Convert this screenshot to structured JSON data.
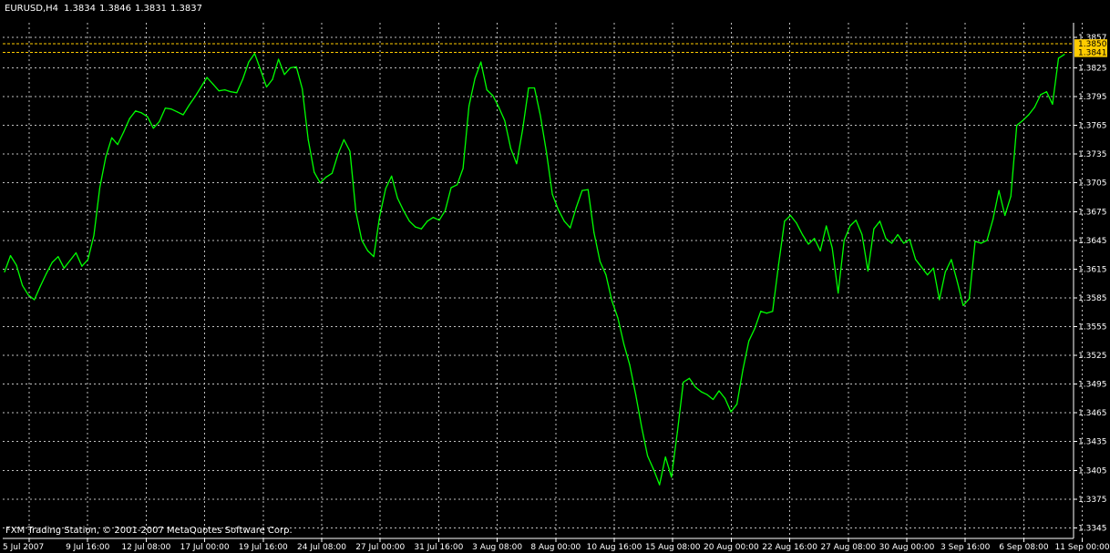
{
  "header": {
    "symbol": "EURUSD,H4",
    "open": "1.3834",
    "high": "1.3846",
    "low": "1.3831",
    "close": "1.3837"
  },
  "footer": {
    "copyright": "FXM Trading Station, © 2001-2007 MetaQuotes Software Corp."
  },
  "colors": {
    "background": "#000000",
    "grid": "#c0c0c0",
    "axis": "#ffffff",
    "line": "#00ff00",
    "price_tag": "#ffcc00"
  },
  "chart_data": {
    "type": "line",
    "title": "EURUSD,H4",
    "xlabel": "",
    "ylabel": "",
    "grid": true,
    "ylim": [
      1.3334,
      1.3872
    ],
    "y_ticks": [
      "1.3345",
      "1.3375",
      "1.3405",
      "1.3435",
      "1.3465",
      "1.3495",
      "1.3525",
      "1.3555",
      "1.3585",
      "1.3615",
      "1.3645",
      "1.3675",
      "1.3705",
      "1.3735",
      "1.3765",
      "1.3795",
      "1.3825",
      "1.3857"
    ],
    "x_ticks": [
      "5 Jul 2007",
      "9 Jul 16:00",
      "12 Jul 08:00",
      "17 Jul 00:00",
      "19 Jul 16:00",
      "24 Jul 08:00",
      "27 Jul 00:00",
      "31 Jul 16:00",
      "3 Aug 08:00",
      "8 Aug 00:00",
      "10 Aug 16:00",
      "15 Aug 08:00",
      "20 Aug 00:00",
      "22 Aug 16:00",
      "27 Aug 08:00",
      "30 Aug 00:00",
      "3 Sep 16:00",
      "6 Sep 08:00",
      "11 Sep 00:00"
    ],
    "price_tags": [
      {
        "label": "1.3850",
        "value": 1.385,
        "color": "#ffcc00"
      },
      {
        "label": "1.3841",
        "value": 1.3841,
        "color": "#ffcc00"
      }
    ],
    "series": [
      {
        "values": [
          [
            0,
            1.3612
          ],
          [
            1,
            1.3629
          ],
          [
            2,
            1.3619
          ],
          [
            3,
            1.3598
          ],
          [
            4,
            1.3588
          ],
          [
            5,
            1.3583
          ],
          [
            6,
            1.3597
          ],
          [
            7,
            1.361
          ],
          [
            8,
            1.3622
          ],
          [
            9,
            1.3628
          ],
          [
            10,
            1.3616
          ],
          [
            11,
            1.3624
          ],
          [
            12,
            1.3632
          ],
          [
            13,
            1.3618
          ],
          [
            14,
            1.3625
          ],
          [
            15,
            1.365
          ],
          [
            16,
            1.37
          ],
          [
            17,
            1.3732
          ],
          [
            18,
            1.3752
          ],
          [
            19,
            1.3745
          ],
          [
            20,
            1.3758
          ],
          [
            21,
            1.3772
          ],
          [
            22,
            1.378
          ],
          [
            23,
            1.3778
          ],
          [
            24,
            1.3774
          ],
          [
            25,
            1.3762
          ],
          [
            26,
            1.3769
          ],
          [
            27,
            1.3783
          ],
          [
            28,
            1.3782
          ],
          [
            29,
            1.3779
          ],
          [
            30,
            1.3776
          ],
          [
            31,
            1.3786
          ],
          [
            32,
            1.3795
          ],
          [
            33,
            1.3805
          ],
          [
            34,
            1.3815
          ],
          [
            35,
            1.3808
          ],
          [
            36,
            1.3801
          ],
          [
            37,
            1.3802
          ],
          [
            38,
            1.38
          ],
          [
            39,
            1.3799
          ],
          [
            40,
            1.3813
          ],
          [
            41,
            1.3831
          ],
          [
            42,
            1.384
          ],
          [
            43,
            1.3823
          ],
          [
            44,
            1.3805
          ],
          [
            45,
            1.3813
          ],
          [
            46,
            1.3834
          ],
          [
            47,
            1.3818
          ],
          [
            48,
            1.3825
          ],
          [
            49,
            1.3826
          ],
          [
            50,
            1.3803
          ],
          [
            51,
            1.375
          ],
          [
            52,
            1.3716
          ],
          [
            53,
            1.3705
          ],
          [
            54,
            1.3711
          ],
          [
            55,
            1.3715
          ],
          [
            56,
            1.3735
          ],
          [
            57,
            1.375
          ],
          [
            58,
            1.3738
          ],
          [
            59,
            1.3675
          ],
          [
            60,
            1.3645
          ],
          [
            61,
            1.3634
          ],
          [
            62,
            1.3628
          ],
          [
            63,
            1.367
          ],
          [
            64,
            1.3699
          ],
          [
            65,
            1.3712
          ],
          [
            66,
            1.3689
          ],
          [
            67,
            1.3676
          ],
          [
            68,
            1.3665
          ],
          [
            69,
            1.3659
          ],
          [
            70,
            1.3657
          ],
          [
            71,
            1.3665
          ],
          [
            72,
            1.3669
          ],
          [
            73,
            1.3666
          ],
          [
            74,
            1.3676
          ],
          [
            75,
            1.37
          ],
          [
            76,
            1.3703
          ],
          [
            77,
            1.372
          ],
          [
            78,
            1.3785
          ],
          [
            79,
            1.3814
          ],
          [
            80,
            1.3831
          ],
          [
            81,
            1.3802
          ],
          [
            82,
            1.3796
          ],
          [
            83,
            1.3784
          ],
          [
            84,
            1.377
          ],
          [
            85,
            1.3741
          ],
          [
            86,
            1.3725
          ],
          [
            87,
            1.376
          ],
          [
            88,
            1.3804
          ],
          [
            89,
            1.3804
          ],
          [
            90,
            1.3775
          ],
          [
            91,
            1.3737
          ],
          [
            92,
            1.3693
          ],
          [
            93,
            1.3677
          ],
          [
            94,
            1.3665
          ],
          [
            95,
            1.3658
          ],
          [
            96,
            1.3679
          ],
          [
            97,
            1.3697
          ],
          [
            98,
            1.3698
          ],
          [
            99,
            1.3653
          ],
          [
            100,
            1.3623
          ],
          [
            101,
            1.3609
          ],
          [
            102,
            1.3582
          ],
          [
            103,
            1.3564
          ],
          [
            104,
            1.3537
          ],
          [
            105,
            1.3515
          ],
          [
            106,
            1.3484
          ],
          [
            107,
            1.345
          ],
          [
            108,
            1.342
          ],
          [
            109,
            1.3406
          ],
          [
            110,
            1.339
          ],
          [
            111,
            1.3419
          ],
          [
            112,
            1.3398
          ],
          [
            113,
            1.3445
          ],
          [
            114,
            1.3497
          ],
          [
            115,
            1.3501
          ],
          [
            116,
            1.3492
          ],
          [
            117,
            1.3487
          ],
          [
            118,
            1.3484
          ],
          [
            119,
            1.3479
          ],
          [
            120,
            1.3488
          ],
          [
            121,
            1.348
          ],
          [
            122,
            1.3466
          ],
          [
            123,
            1.3474
          ],
          [
            124,
            1.351
          ],
          [
            125,
            1.354
          ],
          [
            126,
            1.3553
          ],
          [
            127,
            1.3571
          ],
          [
            128,
            1.3569
          ],
          [
            129,
            1.3571
          ],
          [
            130,
            1.362
          ],
          [
            131,
            1.3665
          ],
          [
            132,
            1.3671
          ],
          [
            133,
            1.3663
          ],
          [
            134,
            1.3651
          ],
          [
            135,
            1.3641
          ],
          [
            136,
            1.3647
          ],
          [
            137,
            1.3634
          ],
          [
            138,
            1.366
          ],
          [
            139,
            1.3637
          ],
          [
            140,
            1.359
          ],
          [
            141,
            1.3645
          ],
          [
            142,
            1.366
          ],
          [
            143,
            1.3666
          ],
          [
            144,
            1.3651
          ],
          [
            145,
            1.3613
          ],
          [
            146,
            1.3657
          ],
          [
            147,
            1.3665
          ],
          [
            148,
            1.3647
          ],
          [
            149,
            1.3642
          ],
          [
            150,
            1.3651
          ],
          [
            151,
            1.3642
          ],
          [
            152,
            1.3646
          ],
          [
            153,
            1.3625
          ],
          [
            154,
            1.3617
          ],
          [
            155,
            1.3609
          ],
          [
            156,
            1.3616
          ],
          [
            157,
            1.3583
          ],
          [
            158,
            1.3612
          ],
          [
            159,
            1.3625
          ],
          [
            160,
            1.3602
          ],
          [
            161,
            1.3577
          ],
          [
            162,
            1.3584
          ],
          [
            163,
            1.3644
          ],
          [
            164,
            1.3642
          ],
          [
            165,
            1.3645
          ],
          [
            166,
            1.3667
          ],
          [
            167,
            1.3697
          ],
          [
            168,
            1.3671
          ],
          [
            169,
            1.3691
          ],
          [
            170,
            1.3765
          ],
          [
            171,
            1.377
          ],
          [
            172,
            1.3776
          ],
          [
            173,
            1.3784
          ],
          [
            174,
            1.3797
          ],
          [
            175,
            1.38
          ],
          [
            176,
            1.3787
          ],
          [
            177,
            1.3835
          ],
          [
            178,
            1.3839
          ]
        ]
      }
    ]
  }
}
